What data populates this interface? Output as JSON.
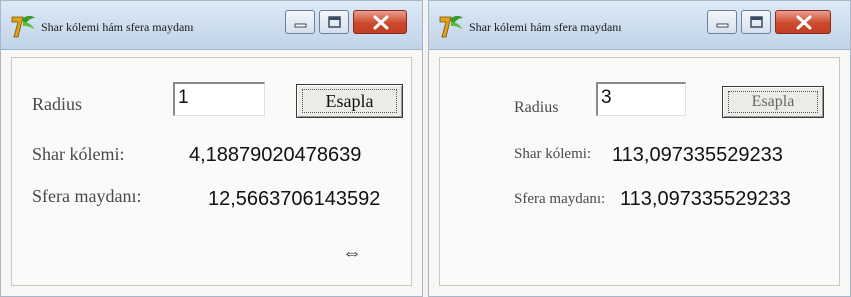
{
  "windows": [
    {
      "title": "Shar kólemi hám sfera maydanı",
      "radius_label": "Radius",
      "radius_value": "1",
      "calc_button": "Esapla",
      "volume_label": "Shar kólemi:",
      "volume_value": "4,18879020478639",
      "area_label": "Sfera maydanı:",
      "area_value": "12,5663706143592",
      "resize_cursor": "⇔"
    },
    {
      "title": "Shar kólemi hám sfera maydanı",
      "radius_label": "Radius",
      "radius_value": "3",
      "calc_button": "Esapla",
      "volume_label": "Shar kólemi:",
      "volume_value": "113,097335529233",
      "area_label": "Sfera maydanı:",
      "area_value": "113,097335529233"
    }
  ],
  "icons": {
    "app": "app-icon",
    "minimize": "minimize-icon",
    "maximize": "maximize-icon",
    "close": "close-icon",
    "cursor": "resize-cursor-icon"
  },
  "colors": {
    "titlebar": "#cbdcee",
    "close_button": "#cc4a2e",
    "window_bg": "#f7f7f5"
  }
}
